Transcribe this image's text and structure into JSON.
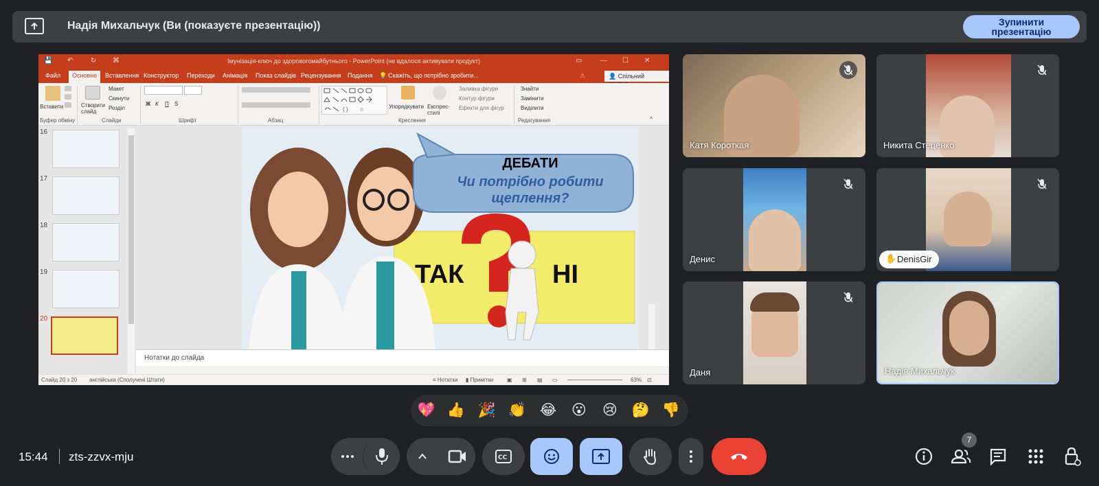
{
  "banner": {
    "title": "Надія Михальчук (Ви (показуєте презентацію))",
    "stop_line1": "Зупинити",
    "stop_line2": "презентацію"
  },
  "ppt": {
    "window_title": "Імунізація-ключ до здоровогомайбутнього - PowerPoint (не вдалося активувати продукт)",
    "tabs": [
      "Файл",
      "Основне",
      "Вставлення",
      "Конструктор",
      "Переходи",
      "Анімація",
      "Показ слайдів",
      "Рецензування",
      "Подання"
    ],
    "tell_me": "Скажіть, що потрібно зробити...",
    "share": "Спільний доступ",
    "ribbon": {
      "paste": "Вставити",
      "new_slide": "Створити слайд",
      "layout": "Макет",
      "reset": "Скинути",
      "section": "Розділ",
      "arrange": "Упорядкувати",
      "quick_styles": "Експрес-стилі",
      "shape_fill": "Заливка фігури",
      "shape_outline": "Контур фігури",
      "shape_effects": "Ефекти для фігур",
      "find": "Знайти",
      "replace": "Замінити",
      "select": "Виділити",
      "groups": [
        "Буфер обміну",
        "Слайди",
        "Шрифт",
        "Абзац",
        "Креслення",
        "Редагування"
      ]
    },
    "thumbnails": [
      "16",
      "17",
      "18",
      "19",
      "20"
    ],
    "slide": {
      "heading": "ДЕБАТИ",
      "question": "Чи потрібно робити щеплення?",
      "yes": "ТАК",
      "no": "НІ"
    },
    "notes_placeholder": "Нотатки до слайда",
    "status": {
      "slide_count": "Слайд 20 з 20",
      "language": "англійська (Сполучені Штати)",
      "notes": "Нотатки",
      "comments": "Примітки",
      "zoom": "63%"
    }
  },
  "participants": [
    {
      "name": "Катя Короткая",
      "muted": true
    },
    {
      "name": "Никита Стеценко",
      "muted": true
    },
    {
      "name": "Денис",
      "muted": true
    },
    {
      "name": "DenisGir",
      "muted": true
    },
    {
      "name": "Даня",
      "muted": true
    },
    {
      "name": "Надія Михальчук",
      "muted": false
    }
  ],
  "reactions": [
    "💖",
    "👍",
    "🎉",
    "👏",
    "😂",
    "😮",
    "😢",
    "🤔",
    "👎"
  ],
  "bottom": {
    "time": "15:44",
    "meeting_code": "zts-zzvx-mju",
    "people_count": "7"
  },
  "colors": {
    "background": "#202124",
    "tile": "#3c4043",
    "accent": "#a8c7fa",
    "end_call": "#ea4335",
    "powerpoint": "#c43e1c"
  }
}
